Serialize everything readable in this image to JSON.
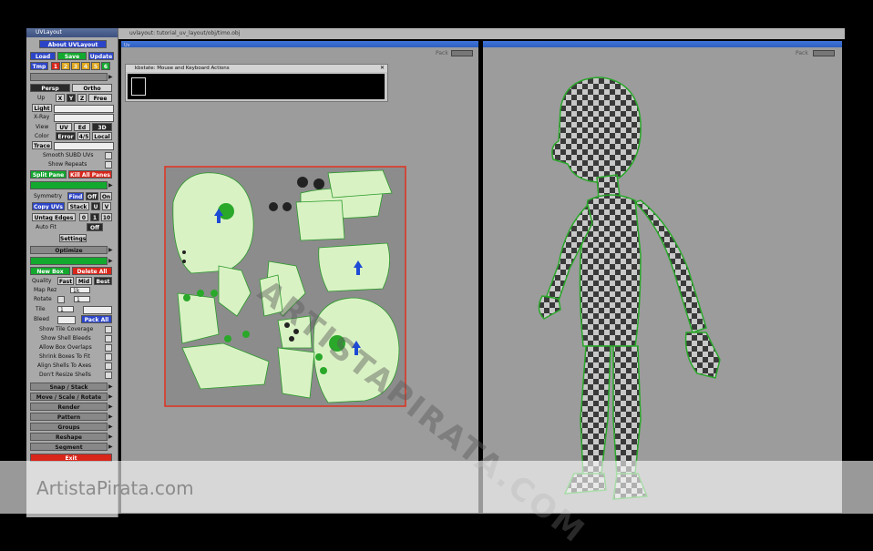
{
  "panel": {
    "title": "UVLayout",
    "about": "About UVLayout",
    "load": "Load",
    "save": "Save",
    "update": "Update",
    "tmp": "Tmp",
    "tmp_slots": [
      "1",
      "2",
      "3",
      "4",
      "5",
      "6"
    ],
    "persp": "Persp",
    "ortho": "Ortho",
    "up": "Up",
    "axes": [
      "X",
      "Y",
      "Z"
    ],
    "free": "Free",
    "light": "Light",
    "xray": "X-Ray",
    "view": "View",
    "view_opts": [
      "UV",
      "Ed",
      "3D"
    ],
    "color": "Color",
    "color_opts": [
      "Error",
      "4/5",
      "Local"
    ],
    "trace": "Trace",
    "smooth_subd": "Smooth SUBD UVs",
    "show_repeats": "Show Repeats",
    "split_pane": "Split Pane",
    "kill_all_panes": "Kill All Panes",
    "symmetry": "Symmetry",
    "find": "Find",
    "off": "Off",
    "on": "On",
    "copy_uvs": "Copy UVs",
    "stack": "Stack",
    "u": "U",
    "v": "V",
    "untag_edges": "Untag Edges",
    "num0": "0",
    "num1": "1",
    "num10": "10",
    "auto_fit": "Auto Fit",
    "auto_fit_off": "Off",
    "settings": "Settings",
    "optimize": "Optimize",
    "new_box": "New Box",
    "delete_all": "Delete All",
    "quality": "Quality",
    "quality_opts": [
      "Fast",
      "Mid",
      "Best"
    ],
    "map_rez": "Map Rez",
    "map_rez_val": "1k",
    "rotate": "Rotate",
    "rotate_val": "1",
    "tile": "Tile",
    "tile_val": "1",
    "bleed": "Bleed",
    "pack_all": "Pack All",
    "checks": [
      "Show Tile Coverage",
      "Show Shell Bleeds",
      "Allow Box Overlaps",
      "Shrink Boxes To Fit",
      "Align Shells To Axes",
      "Don't Resize Shells"
    ],
    "sections": [
      "Snap / Stack",
      "Move / Scale / Rotate",
      "Render",
      "Pattern",
      "Groups",
      "Reshape",
      "Segment"
    ],
    "exit": "Exit",
    "accent_blue": "#2c45c8",
    "accent_green": "#13a82e",
    "accent_red": "#d8261b"
  },
  "main": {
    "window_title": "uvlayout: tutorial_uv_layout/obj/timo.obj",
    "left_view_label": "Uv",
    "pack_label": "Pack",
    "keystate_title": "kbstate: Mouse and Keyboard Actions"
  },
  "watermark": {
    "diagonal": "ARTISTAPIRATA.COM",
    "bottom": "ArtistaPirata.com"
  }
}
